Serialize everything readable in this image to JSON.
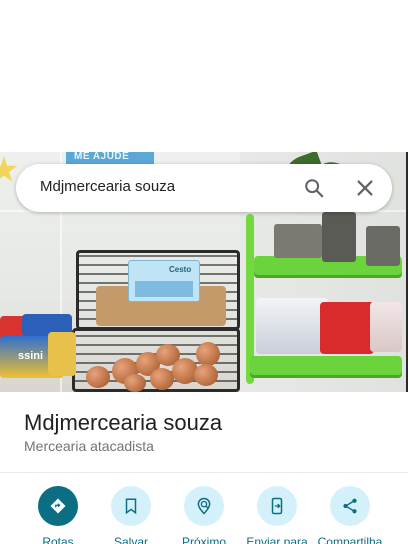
{
  "search": {
    "query": "Mdjmercearia souza"
  },
  "photo": {
    "banner_text": "ME AJUDE",
    "crate_label": "Cesto",
    "snack_brand": "ssini"
  },
  "place": {
    "name": "Mdjmercearia souza",
    "category": "Mercearia atacadista"
  },
  "actions": [
    {
      "label": "Rotas",
      "icon": "directions-icon"
    },
    {
      "label": "Salvar",
      "icon": "bookmark-icon"
    },
    {
      "label": "Próximo",
      "icon": "nearby-icon"
    },
    {
      "label": "Enviar para",
      "icon": "send-to-phone-icon"
    },
    {
      "label": "Compartilha",
      "icon": "share-icon"
    }
  ],
  "colors": {
    "accent": "#0b6e82",
    "action_bg": "#d4f1fb",
    "primary_text": "#202124",
    "secondary_text": "#70757a"
  }
}
